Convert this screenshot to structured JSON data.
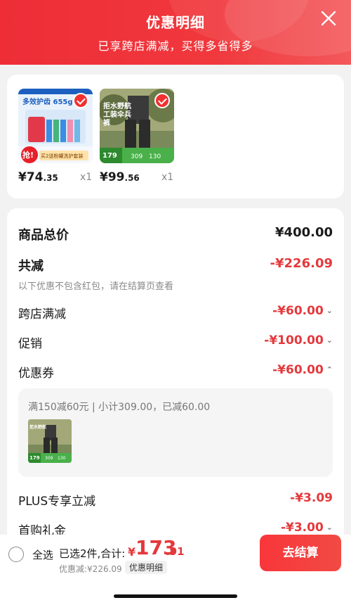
{
  "header": {
    "title": "优惠明细",
    "subtitle": "已享跨店满减，买得多省得多"
  },
  "products": [
    {
      "price_symbol": "¥",
      "price_int": "74",
      "price_dec": ".35",
      "qty": "x1",
      "image_text": "多效护齿 655g",
      "image_tag": "抢!",
      "image_banner": "买2送粉罐洗护套装"
    },
    {
      "price_symbol": "¥",
      "price_int": "99",
      "price_dec": ".56",
      "qty": "x1",
      "image_text": "拒水野航 工装伞兵裤",
      "image_price": "179",
      "image_a": "309",
      "image_b": "130"
    }
  ],
  "summary": {
    "total_label": "商品总价",
    "total_value": "¥400.00",
    "reduced_label": "共减",
    "reduced_value": "-¥226.09",
    "note": "以下优惠不包含红包，请在结算页查看",
    "rows": [
      {
        "label": "跨店满减",
        "value": "-¥60.00",
        "chev": "⌄"
      },
      {
        "label": "促销",
        "value": "-¥100.00",
        "chev": "⌄"
      },
      {
        "label": "优惠券",
        "value": "-¥60.00",
        "chev": "⌃"
      },
      {
        "label": "PLUS专享立减",
        "value": "-¥3.09"
      },
      {
        "label": "首购礼金",
        "value": "-¥3.00",
        "chev": "⌄"
      }
    ],
    "coupon_detail": "满150减60元 | 小计309.00，已减60.00",
    "coupon_thumb": {
      "image_text": "拒水野航",
      "price": "179",
      "a": "309",
      "b": "130"
    }
  },
  "bottom": {
    "select_all": "全选",
    "selected_text": "已选2件,合计:",
    "total_symbol": "¥",
    "total_int": "173",
    "total_dec": ".91",
    "discount_text": "优惠减:¥226.09",
    "detail_link": "优惠明细",
    "checkout": "去结算"
  },
  "colors": {
    "accent": "#e4393c",
    "header": "#ee2d37"
  }
}
